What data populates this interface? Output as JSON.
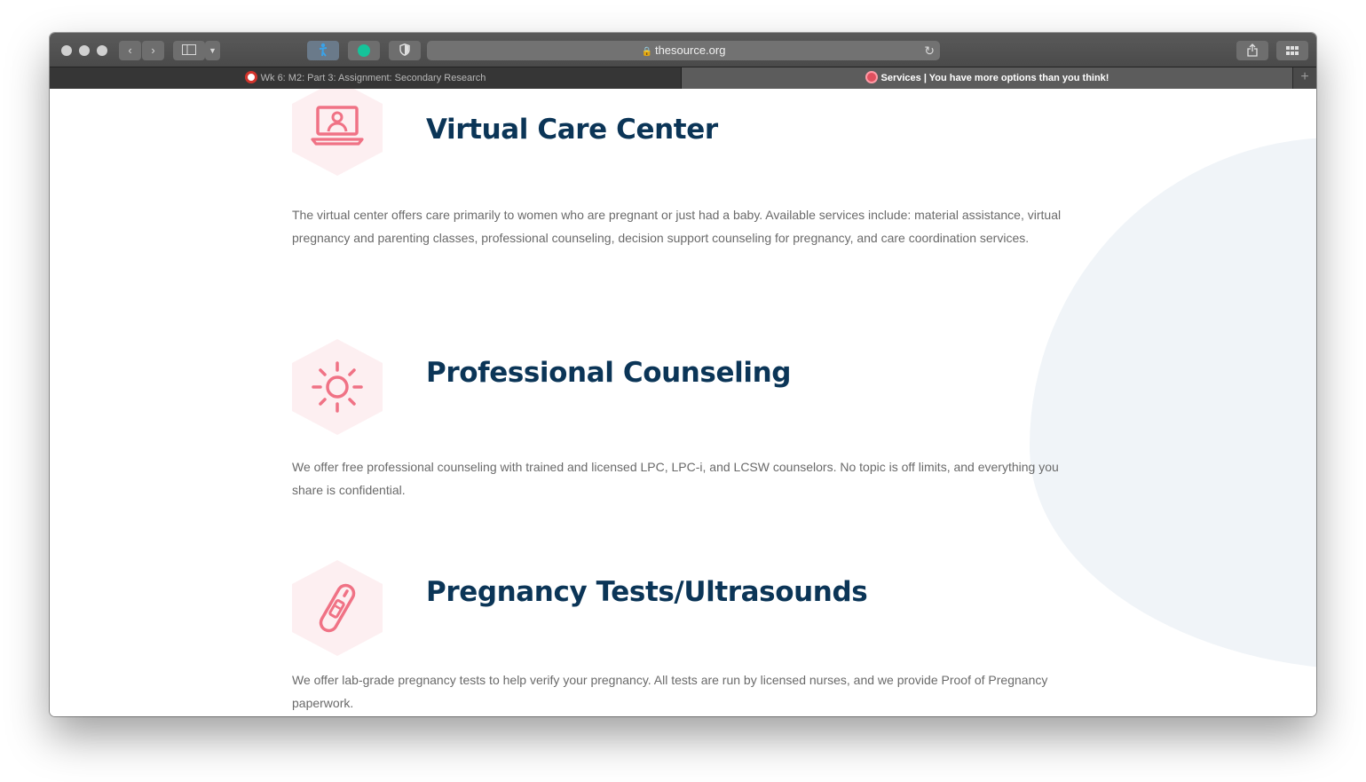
{
  "browser": {
    "url": "thesource.org",
    "tabs": [
      {
        "label": "Wk 6: M2: Part 3: Assignment: Secondary Research",
        "active": false
      },
      {
        "label": "Services | You have more options than you think!",
        "active": true
      }
    ],
    "new_tab_label": "+"
  },
  "colors": {
    "heading": "#0b3557",
    "icon_accent": "#f07285",
    "icon_bg": "#fdeff1",
    "blob": "#f0f4f8"
  },
  "services": [
    {
      "icon": "laptop-person-icon",
      "title": "Virtual Care Center",
      "description": "The virtual center offers care primarily to women who are pregnant or just had a baby. Available services include: material assistance, virtual pregnancy and parenting classes, professional counseling, decision support counseling for pregnancy, and care coordination services."
    },
    {
      "icon": "sun-icon",
      "title": "Professional Counseling",
      "description": "We offer free professional counseling with trained and licensed LPC, LPC-i, and LCSW counselors. No topic is off limits, and everything you share is confidential."
    },
    {
      "icon": "pregnancy-test-icon",
      "title": "Pregnancy Tests/Ultrasounds",
      "description": "We offer lab-grade pregnancy tests to help verify your pregnancy. All tests are run by licensed nurses, and we provide Proof of Pregnancy paperwork."
    }
  ]
}
